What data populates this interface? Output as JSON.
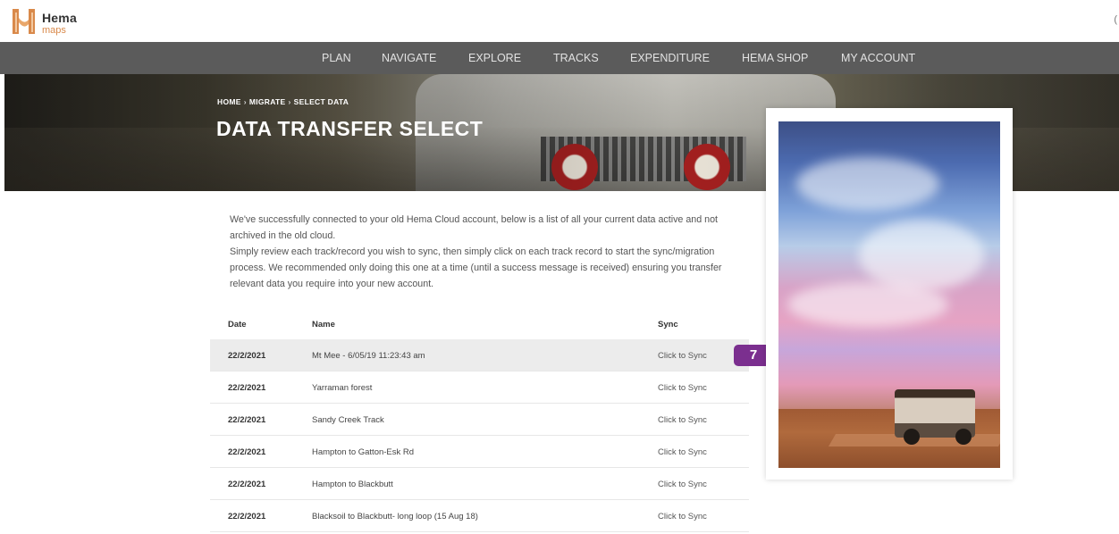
{
  "header": {
    "logo_text": "Hema",
    "logo_subtext": "maps",
    "edge_mark": "("
  },
  "nav": {
    "items": [
      {
        "label": "PLAN"
      },
      {
        "label": "NAVIGATE"
      },
      {
        "label": "EXPLORE"
      },
      {
        "label": "TRACKS"
      },
      {
        "label": "EXPENDITURE"
      },
      {
        "label": "HEMA SHOP"
      },
      {
        "label": "MY ACCOUNT"
      }
    ]
  },
  "hero": {
    "breadcrumb": [
      "HOME",
      "MIGRATE",
      "SELECT DATA"
    ],
    "breadcrumb_separator": "›",
    "title": "DATA TRANSFER SELECT"
  },
  "intro": {
    "text1": "We've successfully connected to your old Hema Cloud account, below is a list of all your current data active and not archived in the old cloud.",
    "text2": "Simply review each track/record you wish to sync, then simply click on each track record to start the sync/migration process. We recommended only doing this one at a time (until a success message is received) ensuring you transfer relevant data you require into your new account."
  },
  "table": {
    "headers": {
      "date": "Date",
      "name": "Name",
      "sync": "Sync"
    },
    "rows": [
      {
        "date": "22/2/2021",
        "name": "Mt Mee - 6/05/19 11:23:43 am",
        "sync": "Click to Sync"
      },
      {
        "date": "22/2/2021",
        "name": "Yarraman forest",
        "sync": "Click to Sync"
      },
      {
        "date": "22/2/2021",
        "name": "Sandy Creek Track",
        "sync": "Click to Sync"
      },
      {
        "date": "22/2/2021",
        "name": "Hampton to Gatton-Esk Rd",
        "sync": "Click to Sync"
      },
      {
        "date": "22/2/2021",
        "name": "Hampton to Blackbutt",
        "sync": "Click to Sync"
      },
      {
        "date": "22/2/2021",
        "name": "Blacksoil to Blackbutt- long loop (15 Aug 18)",
        "sync": "Click to Sync"
      }
    ]
  },
  "badge": {
    "label": "7"
  },
  "colors": {
    "nav_bg": "#5b5b5b",
    "badge_bg": "#7b2f8f",
    "logo_accent": "#d9894a",
    "highlight_row": "#ececec"
  }
}
